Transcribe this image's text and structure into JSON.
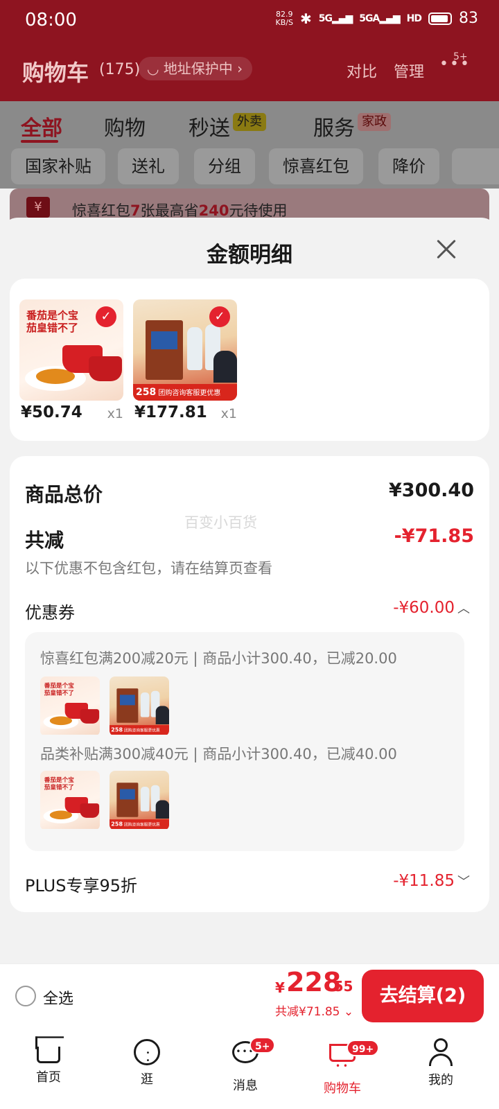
{
  "status": {
    "time": "08:00",
    "net_speed_value": "82.9",
    "net_speed_unit": "KB/S",
    "sig1": "5G",
    "sig2": "5GA",
    "hd": "HD",
    "battery": "83"
  },
  "cart_header": {
    "title": "购物车",
    "count": "(175)",
    "address_pill": "地址保护中",
    "compare": "对比",
    "manage": "管理",
    "more_badge": "5+"
  },
  "tabs": {
    "all": "全部",
    "shopping": "购物",
    "miaosong": "秒送",
    "miaosong_tag": "外卖",
    "service": "服务",
    "service_tag": "家政"
  },
  "chips": [
    "国家补贴",
    "送礼",
    "分组",
    "惊喜红包",
    "降价"
  ],
  "promo": {
    "pre": "惊喜红包",
    "n": "7",
    "mid": "张最高省",
    "amount": "240",
    "post": "元待使用",
    "icon": "¥"
  },
  "sheet": {
    "title": "金额明细"
  },
  "products": [
    {
      "price": "¥50.74",
      "qty": "x1",
      "headline1": "番茄是个宝",
      "headline2": "茄皇错不了"
    },
    {
      "price": "¥177.81",
      "qty": "x1",
      "banner_num": "258",
      "banner_text": "团购咨询客服更优惠"
    }
  ],
  "summary": {
    "total_label": "商品总价",
    "total_value": "¥300.40",
    "reduce_label": "共减",
    "reduce_value": "-¥71.85",
    "watermark": "百变小百货",
    "reduce_note": "以下优惠不包含红包，请在结算页查看",
    "coupon_label": "优惠券",
    "coupon_value": "-¥60.00",
    "coupon_lines": [
      "惊喜红包满200减20元 | 商品小计300.40，已减20.00",
      "品类补贴满300减40元 | 商品小计300.40，已减40.00"
    ],
    "plus_label": "PLUS专享95折",
    "plus_value": "-¥11.85"
  },
  "checkout": {
    "select_all": "全选",
    "currency": "¥",
    "price_int": "228",
    "price_dec": ".55",
    "saved": "共减¥71.85",
    "button": "去结算(2)"
  },
  "nav": [
    {
      "label": "首页",
      "badge": ""
    },
    {
      "label": "逛",
      "badge": ""
    },
    {
      "label": "消息",
      "badge": "5+"
    },
    {
      "label": "购物车",
      "badge": "99+"
    },
    {
      "label": "我的",
      "badge": ""
    }
  ],
  "colors": {
    "brand_red": "#e4222e",
    "header_dim": "#8e1420"
  }
}
